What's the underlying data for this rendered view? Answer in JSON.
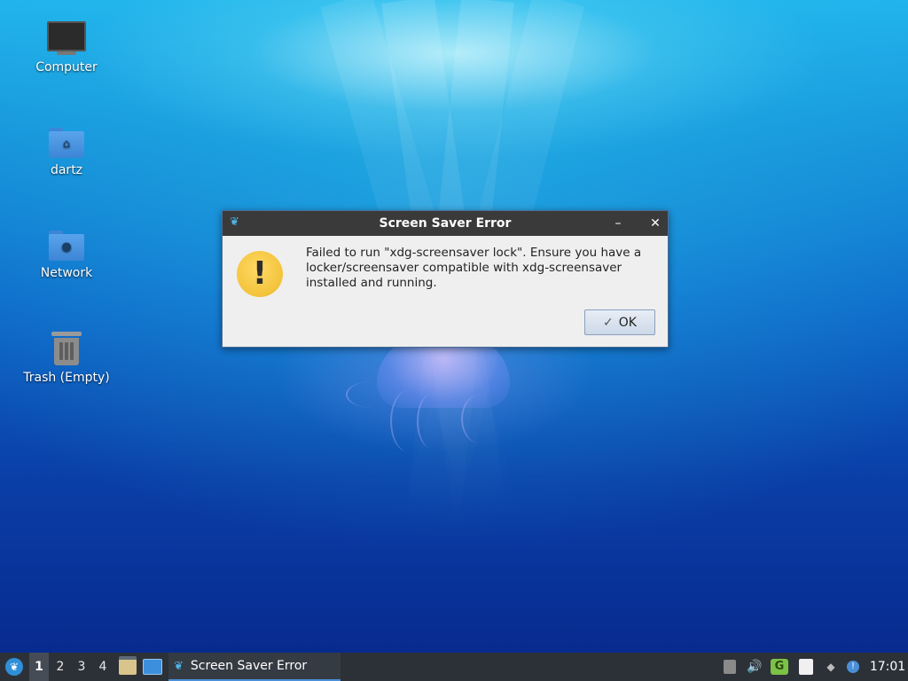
{
  "desktop": {
    "icons": [
      {
        "label": "Computer",
        "icon": "computer-icon"
      },
      {
        "label": "dartz",
        "icon": "home-folder-icon"
      },
      {
        "label": "Network",
        "icon": "network-folder-icon"
      },
      {
        "label": "Trash (Empty)",
        "icon": "trash-icon"
      }
    ]
  },
  "dialog": {
    "title": "Screen Saver Error",
    "message": "Failed to run  \"xdg-screensaver lock\". Ensure you have a locker/screensaver compatible with xdg-screensaver installed and running.",
    "ok_label": "OK",
    "minimize_symbol": "–",
    "close_symbol": "✕",
    "warning_symbol": "!"
  },
  "taskbar": {
    "desktops": [
      "1",
      "2",
      "3",
      "4"
    ],
    "active_desktop": "1",
    "task_title": "Screen Saver Error",
    "clock": "17:01"
  },
  "colors": {
    "taskbar_bg": "#2c3138",
    "dialog_title_bg": "#3a3a3a",
    "warning_yellow": "#f3c33a",
    "accent_blue": "#4a8fd8"
  }
}
